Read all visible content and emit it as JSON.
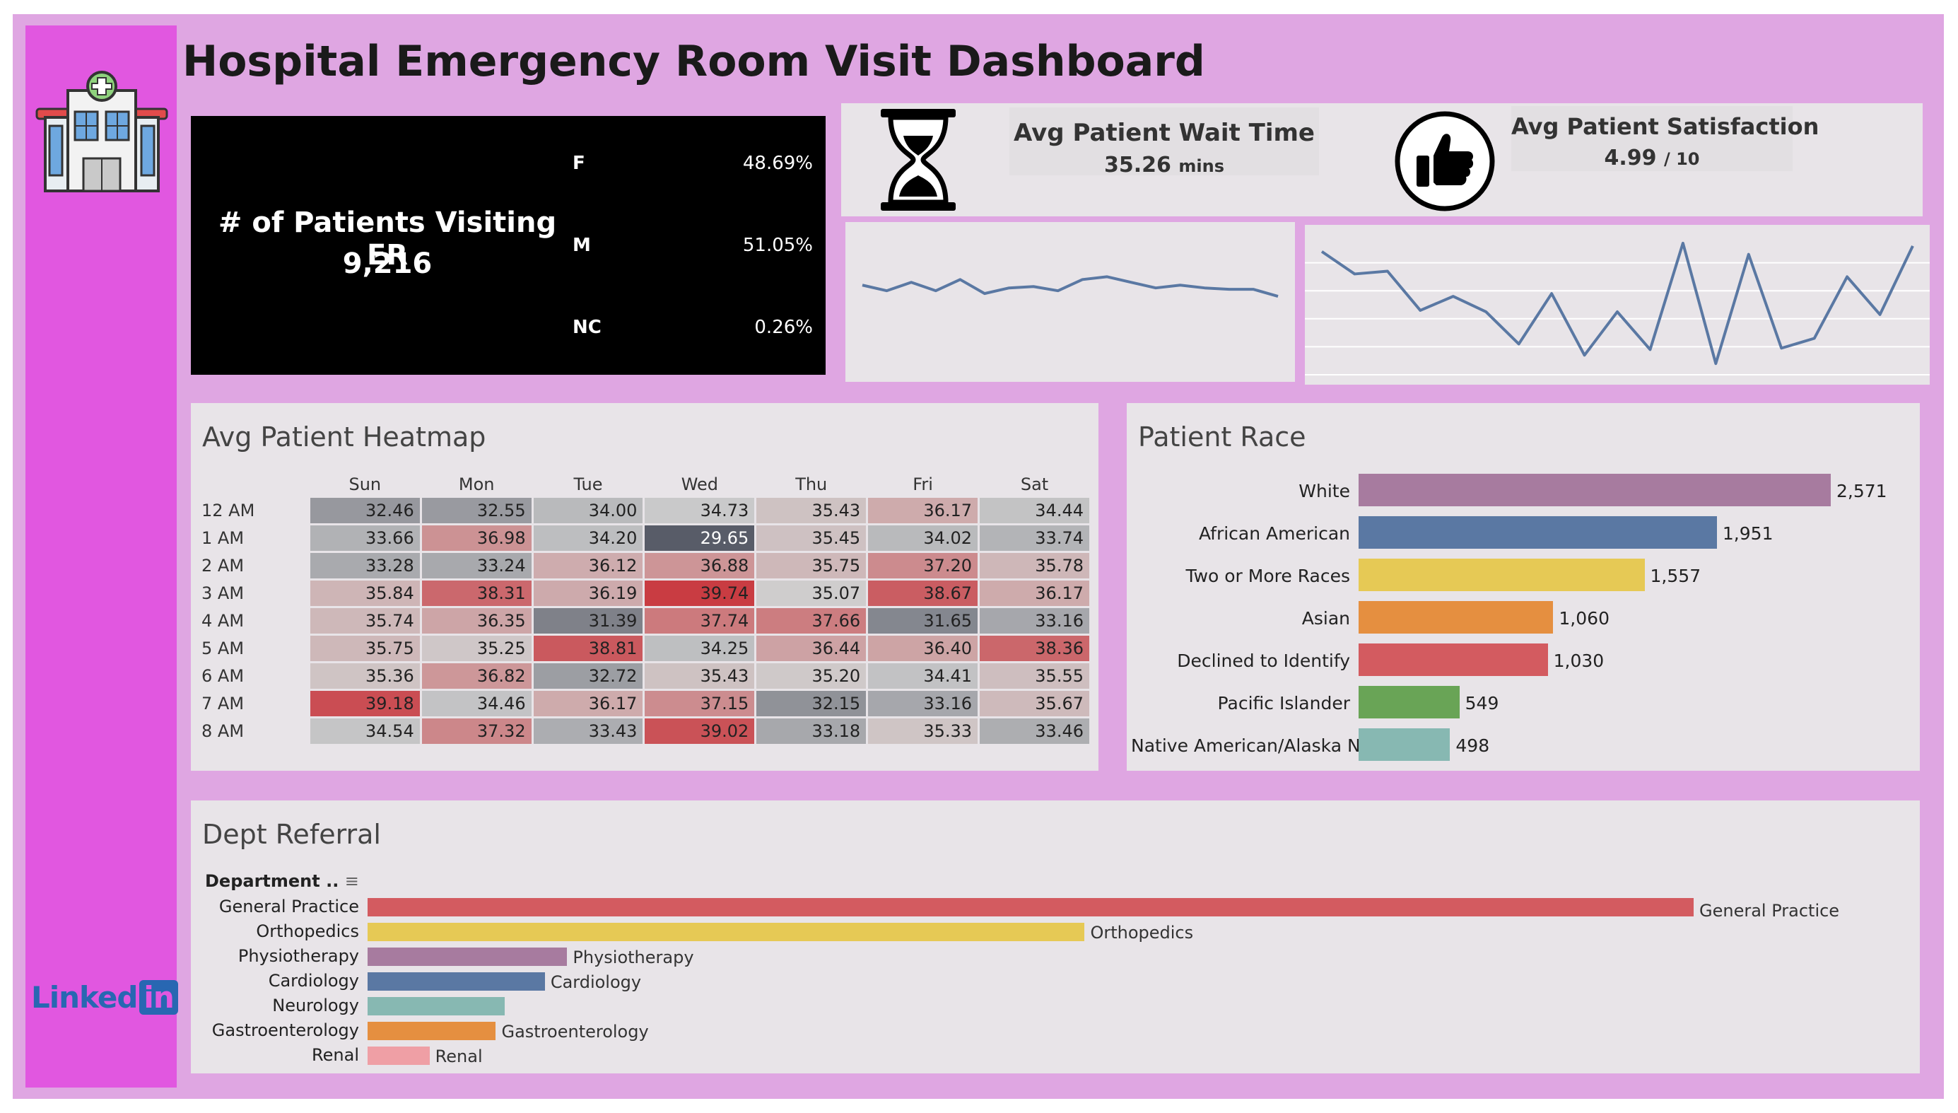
{
  "title": "Hospital Emergency Room Visit Dashboard",
  "patients": {
    "label": "# of Patients Visiting ER",
    "value": "9,216"
  },
  "gender": [
    {
      "code": "F",
      "pct": "48.69%"
    },
    {
      "code": "M",
      "pct": "51.05%"
    },
    {
      "code": "NC",
      "pct": "0.26%"
    }
  ],
  "wait": {
    "label": "Avg Patient Wait Time",
    "value": "35.26",
    "unit": "mins",
    "icon": "hourglass-icon"
  },
  "satisfaction": {
    "label": "Avg Patient Satisfaction",
    "value": "4.99",
    "unit": "/ 10",
    "icon": "thumbs-up-icon"
  },
  "brand": {
    "logo": "Linked",
    "logo_in": "in"
  },
  "colors": {
    "frame": "#dfa6e2",
    "sidebar": "#e157e0",
    "line": "#5a78a3"
  },
  "chart_data": [
    {
      "type": "line",
      "name": "wait_time_trend",
      "y_relative": [
        62,
        58,
        64,
        58,
        66,
        56,
        60,
        61,
        58,
        66,
        68,
        64,
        60,
        62,
        60,
        59,
        59,
        54
      ],
      "grid": false
    },
    {
      "type": "line",
      "name": "satisfaction_trend",
      "y_relative": [
        88,
        72,
        74,
        46,
        56,
        45,
        22,
        58,
        14,
        45,
        18,
        94,
        8,
        86,
        19,
        26,
        70,
        43,
        92
      ],
      "grid": true
    },
    {
      "type": "heatmap",
      "title": "Avg Patient Heatmap",
      "columns": [
        "Sun",
        "Mon",
        "Tue",
        "Wed",
        "Thu",
        "Fri",
        "Sat"
      ],
      "rows": [
        "12 AM",
        "1 AM",
        "2 AM",
        "3 AM",
        "4 AM",
        "5 AM",
        "6 AM",
        "7 AM",
        "8 AM"
      ],
      "values": [
        [
          32.46,
          32.55,
          34.0,
          34.73,
          35.43,
          36.17,
          34.44
        ],
        [
          33.66,
          36.98,
          34.2,
          29.65,
          35.45,
          34.02,
          33.74
        ],
        [
          33.28,
          33.24,
          36.12,
          36.88,
          35.75,
          37.2,
          35.78
        ],
        [
          35.84,
          38.31,
          36.19,
          39.74,
          35.07,
          38.67,
          36.17
        ],
        [
          35.74,
          36.35,
          31.39,
          37.74,
          37.66,
          31.65,
          33.16
        ],
        [
          35.75,
          35.25,
          38.81,
          34.25,
          36.44,
          36.4,
          38.36
        ],
        [
          35.36,
          36.82,
          32.72,
          35.43,
          35.2,
          34.41,
          35.55
        ],
        [
          39.18,
          34.46,
          36.17,
          37.15,
          32.15,
          33.16,
          35.67
        ],
        [
          34.54,
          37.32,
          33.43,
          39.02,
          33.18,
          35.33,
          33.46
        ]
      ]
    },
    {
      "type": "bar",
      "title": "Patient Race",
      "orientation": "horizontal",
      "categories": [
        "White",
        "African American",
        "Two or More Races",
        "Asian",
        "Declined to Identify",
        "Pacific Islander",
        "Native American/Alaska N.."
      ],
      "values": [
        2571,
        1951,
        1557,
        1060,
        1030,
        549,
        498
      ],
      "labels": [
        "2,571",
        "1,951",
        "1,557",
        "1,060",
        "1,030",
        "549",
        "498"
      ],
      "colors": [
        "#a77b9f",
        "#5a78a3",
        "#e6c955",
        "#e58f40",
        "#d35b60",
        "#69a456",
        "#87b8b2"
      ]
    },
    {
      "type": "bar",
      "title": "Dept Referral",
      "orientation": "horizontal",
      "axis_label": "Department ..",
      "categories": [
        "General Practice",
        "Orthopedics",
        "Physiotherapy",
        "Cardiology",
        "Neurology",
        "Gastroenterology",
        "Renal"
      ],
      "bar_labels": [
        "General Practice",
        "Orthopedics",
        "Physiotherapy",
        "Cardiology",
        "",
        "Gastroenterology",
        "Renal"
      ],
      "values": [
        1840,
        995,
        277,
        246,
        190,
        178,
        86
      ],
      "colors": [
        "#d35b60",
        "#e6c955",
        "#a77b9f",
        "#5a78a3",
        "#87b8b2",
        "#e58f40",
        "#ef9fa5"
      ]
    }
  ]
}
